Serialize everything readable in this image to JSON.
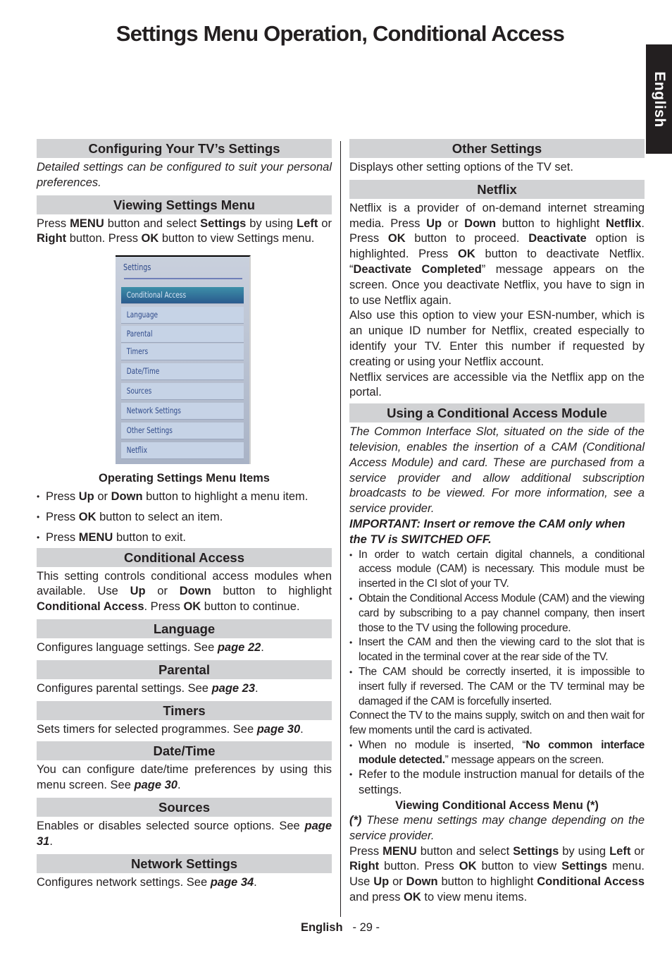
{
  "page": {
    "title": "Settings Menu Operation, Conditional Access",
    "language_tab": "English",
    "footer_language": "English",
    "footer_page": "- 29 -"
  },
  "left": {
    "configuring": {
      "heading": "Configuring Your TV’s Settings",
      "text": "Detailed settings can be configured to suit your personal preferences."
    },
    "viewing": {
      "heading": "Viewing Settings Menu",
      "t1": "Press ",
      "k1": "MENU",
      "t2": " button and select ",
      "k2": "Settings",
      "t3": " by using ",
      "k3": "Left",
      "t4": " or ",
      "k4": "Right",
      "t5": " button. Press ",
      "k5": "OK",
      "t6": " button to view Settings menu."
    },
    "tv_menu": {
      "title": "Settings",
      "items": [
        "Conditional Access",
        "Language",
        "Parental",
        "Timers",
        "Date/Time",
        "Sources",
        "Network Settings",
        "Other Settings",
        "Netflix"
      ],
      "selected_index": 0
    },
    "operating": {
      "caption": "Operating Settings Menu Items",
      "b1": {
        "t1": "Press ",
        "k1": "Up",
        "t2": " or ",
        "k2": "Down",
        "t3": " button to highlight a menu item."
      },
      "b2": {
        "t1": "Press ",
        "k1": "OK",
        "t2": " button to select an item."
      },
      "b3": {
        "t1": "Press ",
        "k1": "MENU",
        "t2": " button to exit."
      }
    },
    "conditional_access": {
      "heading": "Conditional Access",
      "t1": "This setting controls conditional access modules when available. Use ",
      "k1": "Up",
      "t2": " or ",
      "k2": "Down",
      "t3": " button to highlight ",
      "k3": "Conditional Access",
      "t4": ". Press ",
      "k4": "OK",
      "t5": " button to continue."
    },
    "language": {
      "heading": "Language",
      "text": "Configures language settings. See ",
      "page": "page 22",
      "end": "."
    },
    "parental": {
      "heading": "Parental",
      "text": "Configures parental settings. See ",
      "page": "page 23",
      "end": "."
    },
    "timers": {
      "heading": "Timers",
      "text": "Sets timers for selected programmes. See ",
      "page": "page 30",
      "end": "."
    },
    "datetime": {
      "heading": "Date/Time",
      "text": "You can configure date/time preferences by using this menu screen. See ",
      "page": "page 30",
      "end": "."
    },
    "sources": {
      "heading": "Sources",
      "text": "Enables or disables selected source options. See ",
      "page": "page 31",
      "end": "."
    },
    "network": {
      "heading": "Network Settings",
      "text": "Configures network settings. See ",
      "page": "page 34",
      "end": "."
    }
  },
  "right": {
    "other": {
      "heading": "Other Settings",
      "text": "Displays other setting options of the TV set."
    },
    "netflix": {
      "heading": "Netflix",
      "t1": "Netflix is a provider of on-demand internet streaming media. Press ",
      "k1": "Up",
      "t2": " or ",
      "k2": "Down",
      "t3": " button to highlight ",
      "k3": "Netflix",
      "t4": ". Press ",
      "k4": "OK",
      "t5": " button to proceed. ",
      "k5": "Deactivate",
      "t6": " option is highlighted. Press ",
      "k6": "OK",
      "t7": " button to deactivate Netflix. “",
      "k7": "Deactivate Completed",
      "t8": "” message appears on the screen. Once you deactivate Netflix, you have to sign in to use Netflix again.",
      "p2": "Also use this option to view your ESN-number, which is an unique ID number for Netflix, created especially to identify your TV. Enter this number if requested by creating or using your Netflix account.",
      "p3": "Netflix services are accessible via the Netflix app on the portal."
    },
    "cam": {
      "heading": "Using a Conditional Access Module",
      "intro": "The Common Interface Slot, situated on the side of the television, enables the insertion of a CAM (Conditional Access Module) and card. These are purchased from a service provider and allow additional subscription broadcasts to be viewed. For more information, see a service provider.",
      "important": "IMPORTANT: Insert or remove the CAM only when the TV is SWITCHED OFF.",
      "bullets": [
        "In order to watch certain digital channels, a conditional access module (CAM) is necessary. This module must be inserted in the CI slot of your TV.",
        "Obtain the Conditional Access Module (CAM) and the viewing card by subscribing to a pay channel company, then insert those to the TV using the following procedure.",
        "Insert the CAM and then the viewing card to the slot that is located in the terminal cover at the rear side of the TV.",
        "The CAM should be correctly inserted, it is impossible to insert fully if reversed. The CAM or the TV terminal may be damaged if the CAM is forcefully inserted."
      ],
      "connect": "Connect the TV to the mains supply, switch on and then wait for few moments until the card is activated.",
      "b5": {
        "t1": "When no module is inserted, “",
        "k1": "No common interface module detected.",
        "t2": "” message appears on the screen."
      },
      "b6": "Refer to the module instruction manual for details of the settings.",
      "caption": "Viewing Conditional Access Menu (*)",
      "note_mark": "(*)",
      "note": " These menu settings may change depending on the service provider.",
      "final": {
        "t1": "Press ",
        "k1": "MENU",
        "t2": " button and select ",
        "k2": "Settings",
        "t3": " by using ",
        "k3": "Left",
        "t4": " or ",
        "k4": "Right",
        "t5": " button. Press ",
        "k5": "OK",
        "t6": " button to view ",
        "k6": "Settings",
        "t7": " menu. Use ",
        "k7": "Up",
        "t8": " or ",
        "k8": "Down",
        "t9": " button to highlight ",
        "k9": "Conditional Access",
        "t10": " and press ",
        "k10": "OK",
        "t11": " to view menu items."
      }
    }
  }
}
